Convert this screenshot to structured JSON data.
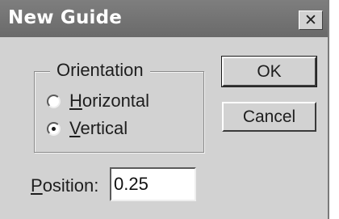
{
  "dialog": {
    "title": "New Guide",
    "close_glyph": "✕",
    "close_icon": "close-icon"
  },
  "orientation": {
    "legend": "Orientation",
    "options": [
      {
        "access_key": "H",
        "rest": "orizontal",
        "checked": false
      },
      {
        "access_key": "V",
        "rest": "ertical",
        "checked": true
      }
    ]
  },
  "buttons": {
    "ok": "OK",
    "cancel": "Cancel"
  },
  "position": {
    "label_key": "P",
    "label_rest": "osition:",
    "value": "0.25"
  },
  "colors": {
    "titlebar": "#747474",
    "dialog_bg": "#d2d2d2",
    "title_text": "#ffffff"
  }
}
